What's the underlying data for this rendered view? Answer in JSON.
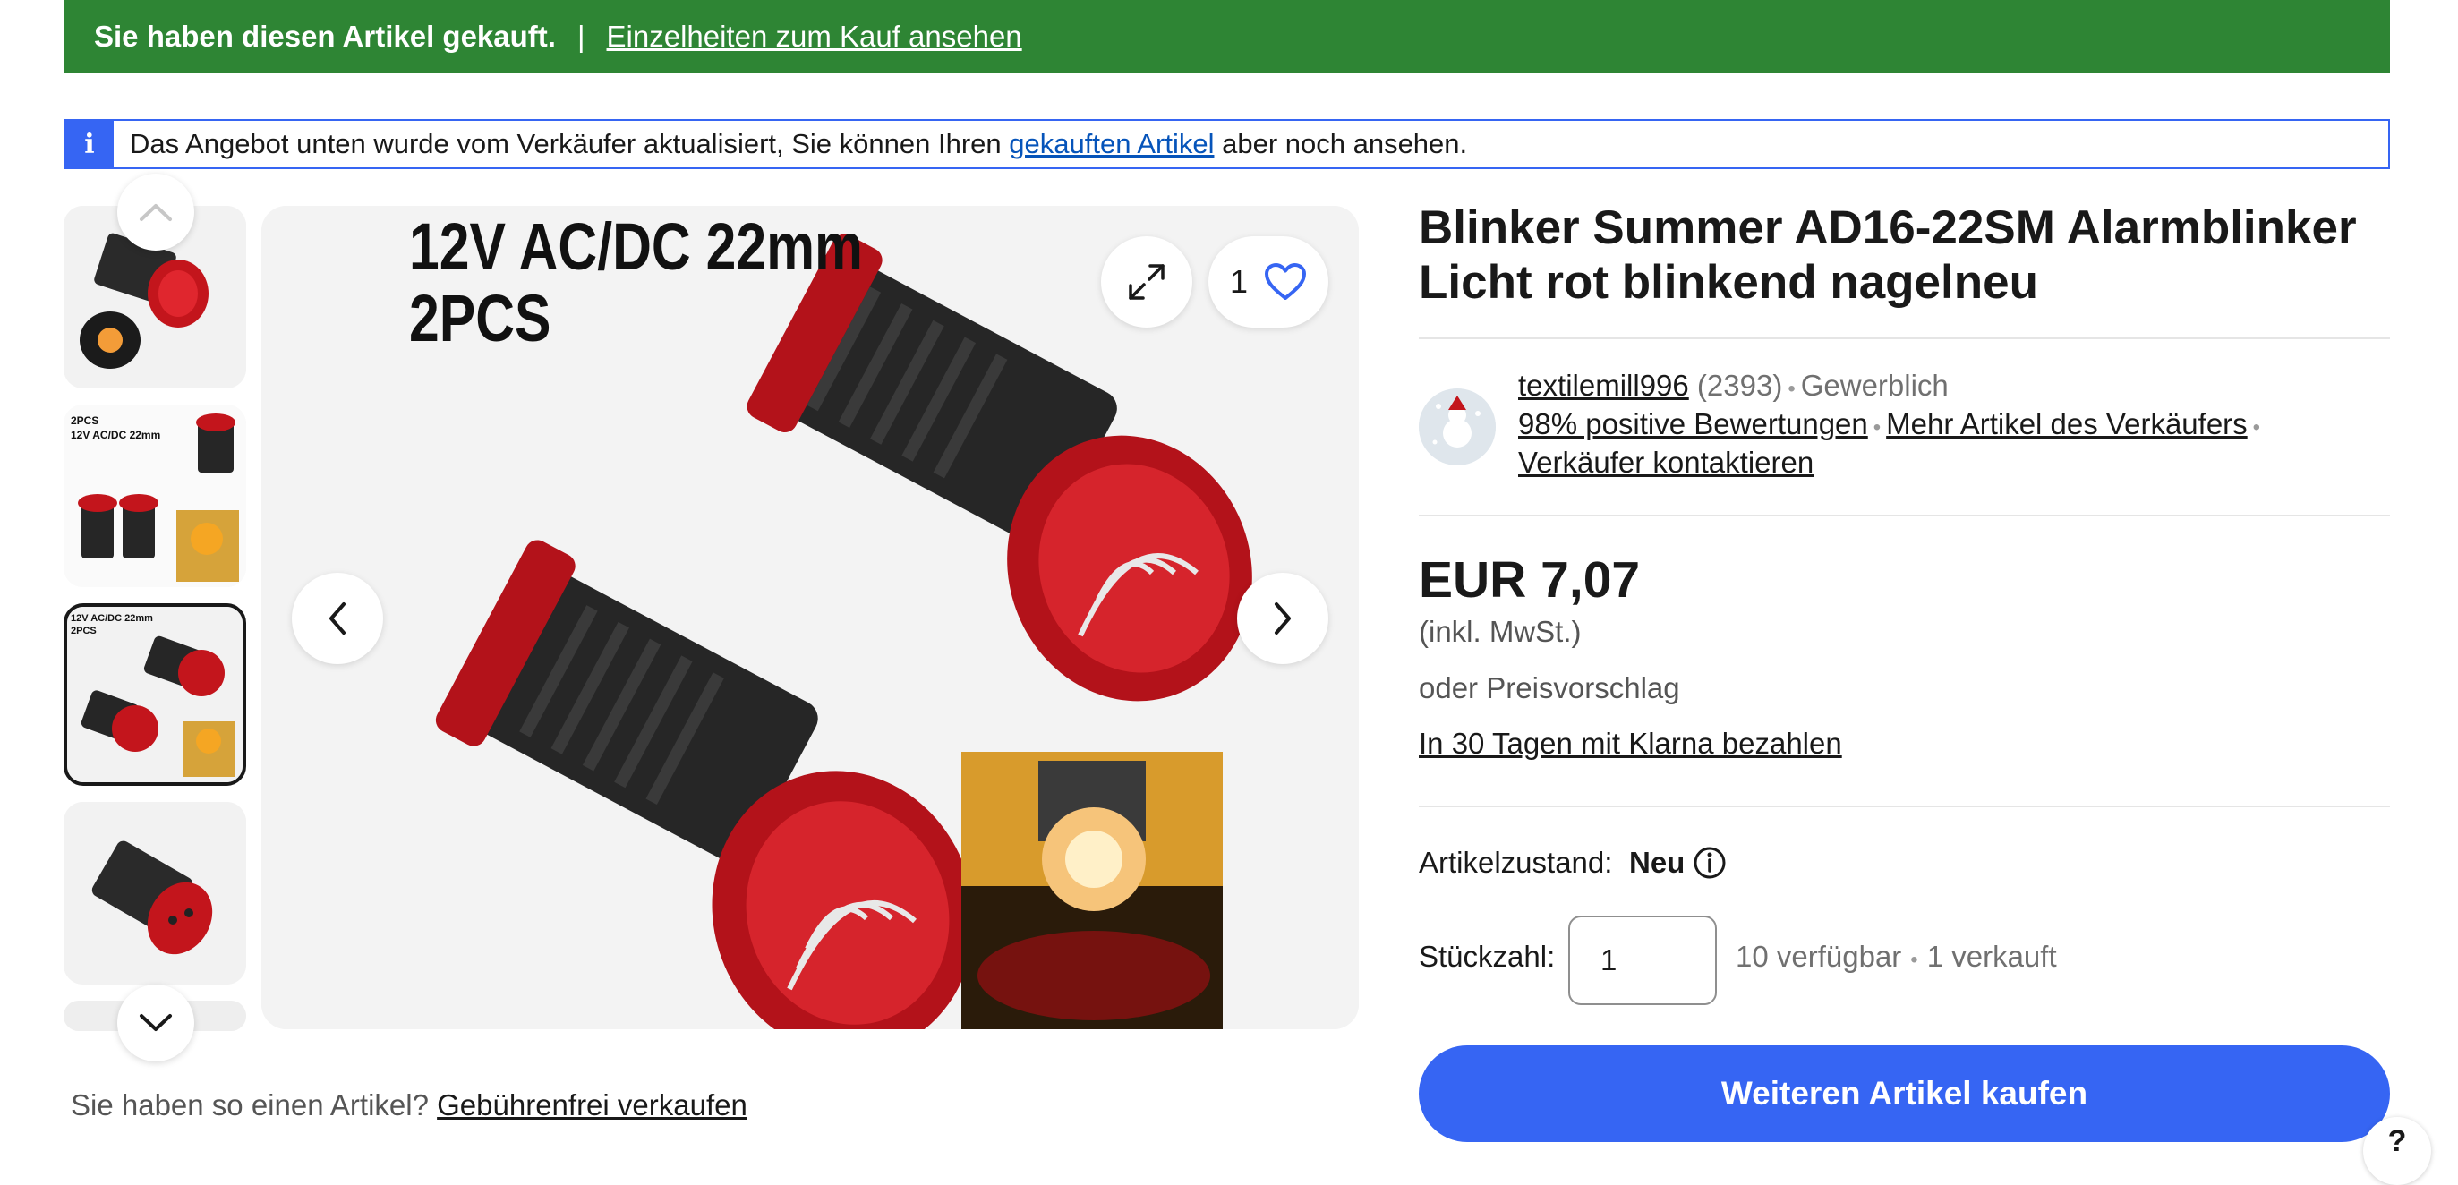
{
  "banner": {
    "purchased_text": "Sie haben diesen Artikel gekauft.",
    "separator": "|",
    "details_link": "Einzelheiten zum Kauf ansehen",
    "color": "#2e8534"
  },
  "notice": {
    "text_before": "Das Angebot unten wurde vom Verkäufer aktualisiert, Sie können Ihren",
    "link": "gekauften Artikel",
    "text_after": "aber noch ansehen.",
    "icon": "info-icon"
  },
  "gallery": {
    "main_image_text_line1": "12V AC/DC 22mm",
    "main_image_text_line2": "2PCS",
    "watch_count": "1",
    "thumb2_caption": "2PCS 12V AC/DC 22mm",
    "thumb3_caption": "12V AC/DC 22mm 2PCS",
    "active_thumbnail": 3
  },
  "item": {
    "title": "Blinker Summer AD16-22SM Alarmblinker Licht rot blinkend nagelneu"
  },
  "seller": {
    "name": "textilemill996",
    "feedback_count": "(2393)",
    "type": "Gewerblich",
    "positive_feedback": "98% positive Bewertungen",
    "more_items": "Mehr Artikel des Verkäufers",
    "contact": "Verkäufer kontaktieren"
  },
  "pricing": {
    "price": "EUR 7,07",
    "tax_note": "(inkl. MwSt.)",
    "best_offer": "oder Preisvorschlag",
    "klarna": "In 30 Tagen mit Klarna bezahlen"
  },
  "condition": {
    "label": "Artikelzustand:",
    "value": "Neu"
  },
  "quantity": {
    "label": "Stückzahl:",
    "value": "1",
    "available": "10 verfügbar",
    "sold": "1 verkauft"
  },
  "actions": {
    "buy_again": "Weiteren Artikel kaufen",
    "accent": "#3665f3"
  },
  "sell_prompt": {
    "question": "Sie haben so einen Artikel?",
    "link": "Gebührenfrei verkaufen"
  },
  "help": {
    "label": "?"
  }
}
